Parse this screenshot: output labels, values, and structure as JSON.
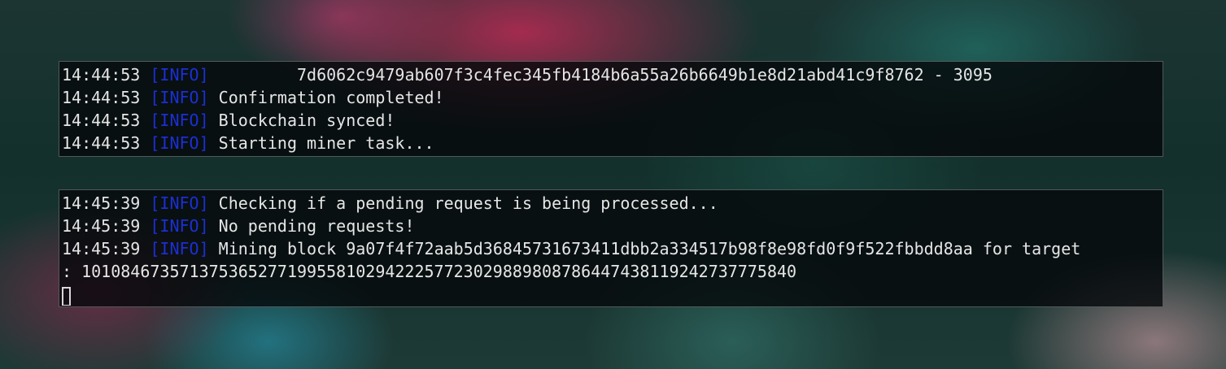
{
  "pane1": {
    "lines": [
      {
        "time": "14:44:53",
        "level": "[INFO]",
        "message": "        7d6062c9479ab607f3c4fec345fb4184b6a55a26b6649b1e8d21abd41c9f8762 - 3095"
      },
      {
        "time": "14:44:53",
        "level": "[INFO]",
        "message": "Confirmation completed!"
      },
      {
        "time": "14:44:53",
        "level": "[INFO]",
        "message": "Blockchain synced!"
      },
      {
        "time": "14:44:53",
        "level": "[INFO]",
        "message": "Starting miner task..."
      }
    ]
  },
  "pane2": {
    "lines": [
      {
        "time": "14:45:39",
        "level": "[INFO]",
        "message": "Checking if a pending request is being processed..."
      },
      {
        "time": "14:45:39",
        "level": "[INFO]",
        "message": "No pending requests!"
      },
      {
        "time": "14:45:39",
        "level": "[INFO]",
        "message": "Mining block 9a07f4f72aab5d36845731673411dbb2a334517b98f8e98fd0f9f522fbbdd8aa for target"
      }
    ],
    "continuation": ": 1010846735713753652771995581029422257723029889808786447438119242737775840"
  },
  "colors": {
    "info_level": "#1c2fd6",
    "text": "#e6e6e6"
  }
}
